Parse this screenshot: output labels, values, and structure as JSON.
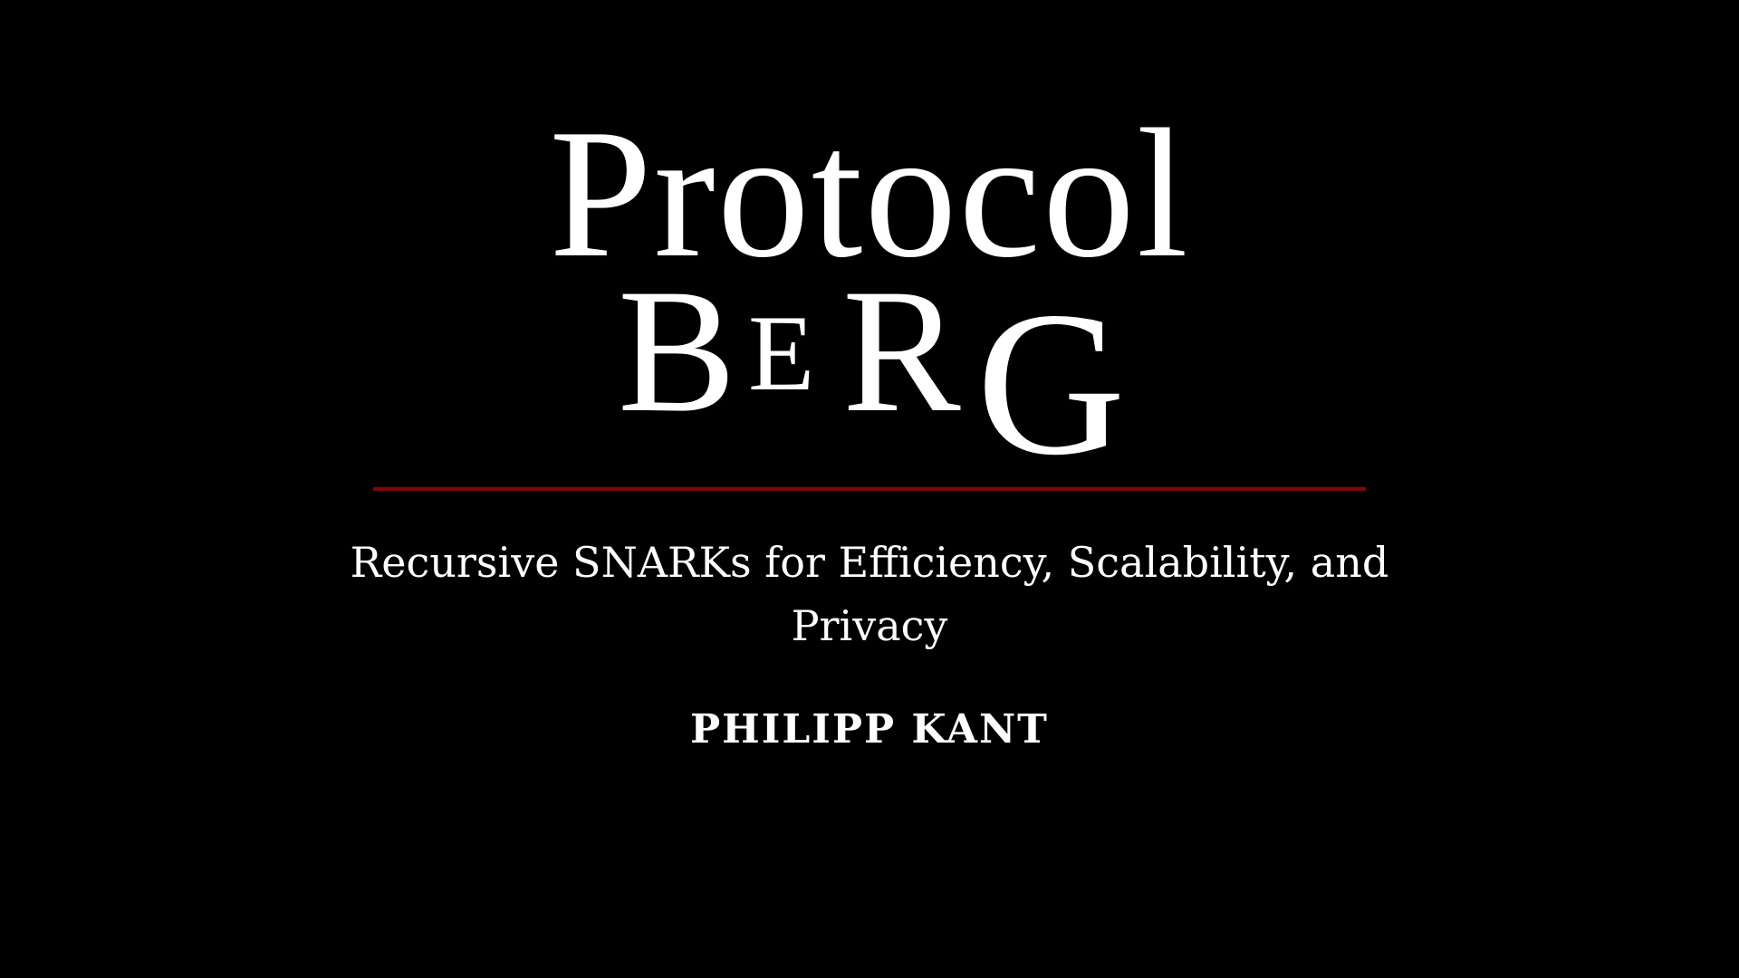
{
  "logo": {
    "line1": "Protocol",
    "line2_letters": [
      "B",
      "E",
      "R",
      "G"
    ]
  },
  "talk": {
    "title": "Recursive SNARKs for Efficiency, Scalability, and Privacy",
    "speaker": "PHILIPP KANT"
  },
  "colors": {
    "background": "#000000",
    "text": "#ffffff",
    "divider": "#8b0000"
  }
}
